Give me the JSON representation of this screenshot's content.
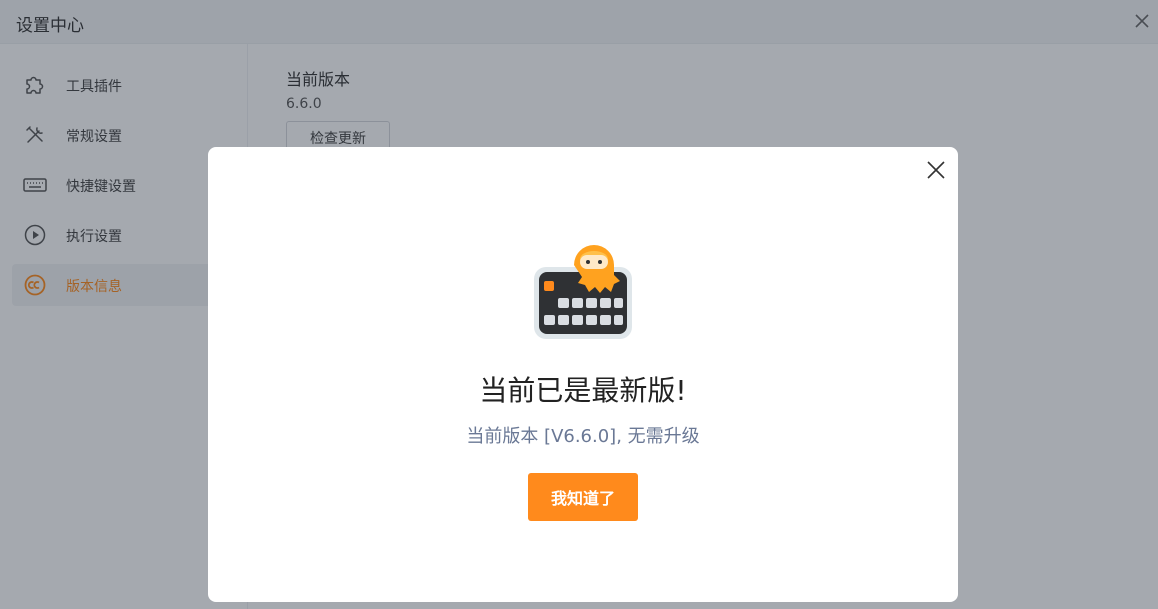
{
  "window": {
    "title": "设置中心"
  },
  "sidebar": {
    "items": [
      {
        "label": "工具插件",
        "icon": "puzzle-icon",
        "active": false
      },
      {
        "label": "常规设置",
        "icon": "tools-icon",
        "active": false
      },
      {
        "label": "快捷键设置",
        "icon": "keyboard-icon",
        "active": false
      },
      {
        "label": "执行设置",
        "icon": "play-circle-icon",
        "active": false
      },
      {
        "label": "版本信息",
        "icon": "copyright-icon",
        "active": true
      }
    ]
  },
  "main": {
    "version_heading": "当前版本",
    "version_number": "6.6.0",
    "check_update_label": "检查更新"
  },
  "dialog": {
    "title": "当前已是最新版!",
    "subtitle": "当前版本 [V6.6.0], 无需升级",
    "ok_label": "我知道了",
    "mascot_icon": "octopus-keyboard-icon"
  },
  "colors": {
    "accent": "#ff8a1c",
    "subtitle": "#6a7895",
    "overlay": "rgba(30,40,55,0.40)"
  }
}
